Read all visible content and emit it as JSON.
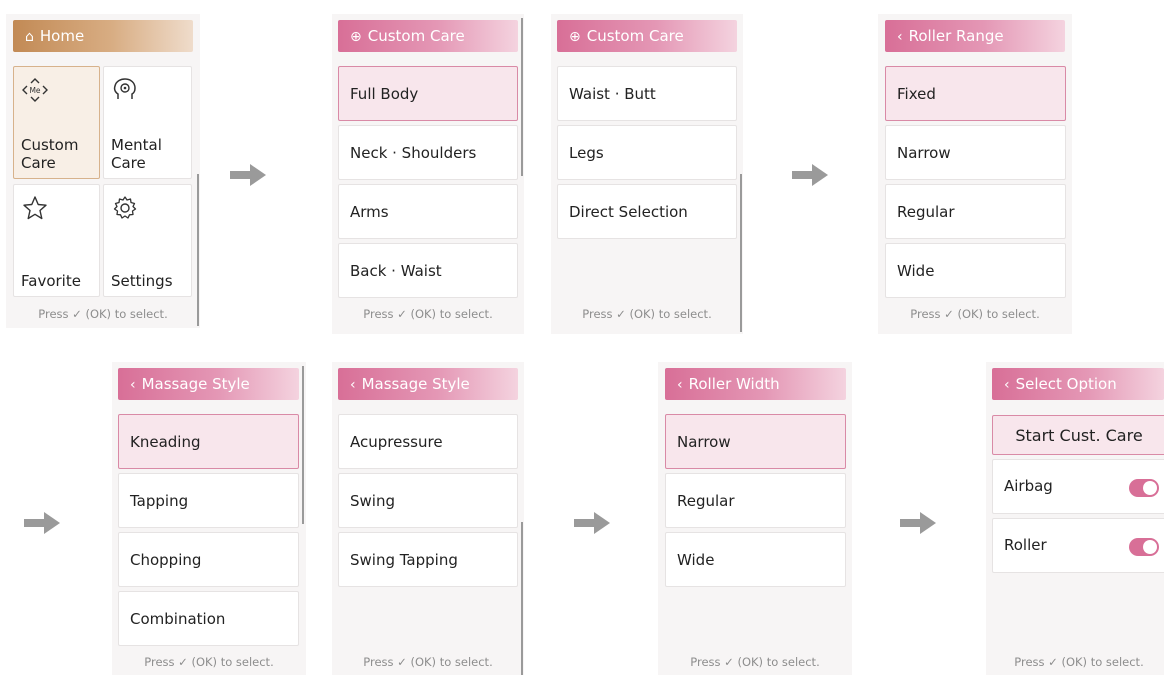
{
  "footer_text": "Press ✓ (OK) to select.",
  "colors": {
    "pink_accent": "#d86f97",
    "gold_accent": "#c28a55",
    "selected_pink": "#f8e6ec"
  },
  "screen_home": {
    "title": "Home",
    "title_icon": "home-icon",
    "tiles": [
      {
        "label_line1": "Custom",
        "label_line2": "Care",
        "icon": "custom-care-icon",
        "icon_text": "Me"
      },
      {
        "label_line1": "Mental",
        "label_line2": "Care",
        "icon": "brain-head-icon"
      },
      {
        "label_line1": "Favorite",
        "icon": "star-icon"
      },
      {
        "label_line1": "Settings",
        "icon": "gear-icon"
      }
    ]
  },
  "screen_custom_care_1": {
    "title": "Custom Care",
    "title_icon": "custom-care-icon",
    "items": [
      "Full Body",
      "Neck · Shoulders",
      "Arms",
      "Back · Waist"
    ]
  },
  "screen_custom_care_2": {
    "title": "Custom Care",
    "title_icon": "custom-care-icon",
    "items": [
      "Waist · Butt",
      "Legs",
      "Direct Selection"
    ]
  },
  "screen_roller_range": {
    "title": "Roller Range",
    "title_icon": "back-chevron-icon",
    "items": [
      "Fixed",
      "Narrow",
      "Regular",
      "Wide"
    ]
  },
  "screen_massage_style_1": {
    "title": "Massage Style",
    "title_icon": "back-chevron-icon",
    "items": [
      "Kneading",
      "Tapping",
      "Chopping",
      "Combination"
    ]
  },
  "screen_massage_style_2": {
    "title": "Massage Style",
    "title_icon": "back-chevron-icon",
    "items": [
      "Acupressure",
      "Swing",
      "Swing Tapping"
    ]
  },
  "screen_roller_width": {
    "title": "Roller Width",
    "title_icon": "back-chevron-icon",
    "items": [
      "Narrow",
      "Regular",
      "Wide"
    ]
  },
  "screen_select_option": {
    "title": "Select Option",
    "title_icon": "back-chevron-icon",
    "start_label": "Start Cust. Care",
    "options": [
      {
        "label": "Airbag",
        "enabled": true
      },
      {
        "label": "Roller",
        "enabled": true
      }
    ]
  }
}
